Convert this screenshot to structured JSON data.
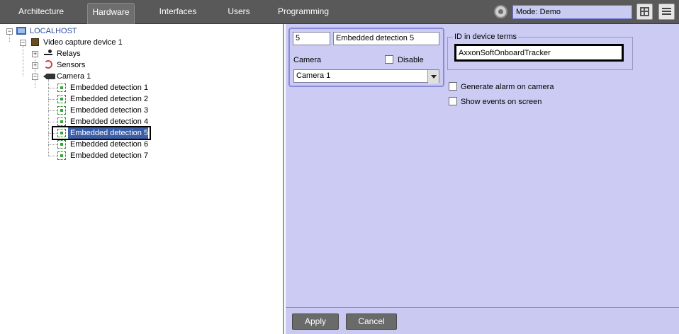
{
  "tabs": [
    {
      "label": "Architecture",
      "active": false
    },
    {
      "label": "Hardware",
      "active": true
    },
    {
      "label": "Interfaces",
      "active": false
    },
    {
      "label": "Users",
      "active": false
    },
    {
      "label": "Programming",
      "active": false
    }
  ],
  "mode": {
    "label": "Mode: Demo"
  },
  "tree": {
    "root": "LOCALHOST",
    "device": "Video capture device 1",
    "relays": "Relays",
    "sensors": "Sensors",
    "camera": "Camera 1",
    "detections": [
      "Embedded detection 1",
      "Embedded detection 2",
      "Embedded detection 3",
      "Embedded detection 4",
      "Embedded detection 5",
      "Embedded detection 6",
      "Embedded detection 7"
    ],
    "selected_index": 4
  },
  "form": {
    "id_value": "5",
    "name_value": "Embedded detection 5",
    "camera_label": "Camera",
    "disable_label": "Disable",
    "camera_value": "Camera 1",
    "id_terms_title": "ID in device terms",
    "id_terms_value": "AxxonSoftOnboardTracker",
    "generate_alarm_label": "Generate alarm on camera",
    "show_events_label": "Show events on screen"
  },
  "buttons": {
    "apply": "Apply",
    "cancel": "Cancel"
  },
  "colors": {
    "topbar": "#595959",
    "panel": "#cbcbf3",
    "mode_box": "#c9cbf0",
    "selection": "#3b5ea8"
  }
}
